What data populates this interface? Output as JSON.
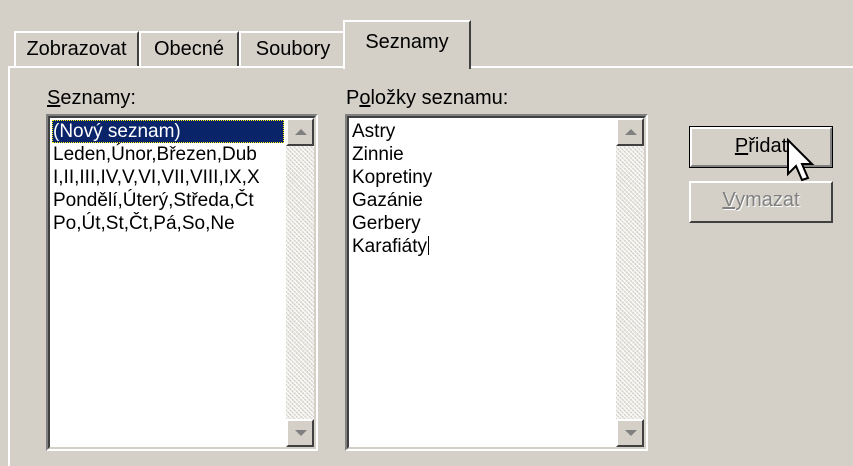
{
  "tabs": [
    {
      "label": "Zobrazovat"
    },
    {
      "label": "Obecné"
    },
    {
      "label": "Soubory"
    },
    {
      "label": "Seznamy"
    }
  ],
  "lists_label": {
    "accel": "S",
    "rest": "eznamy:"
  },
  "items_label": {
    "pre": "P",
    "accel": "o",
    "rest": "ložky seznamu:"
  },
  "lists": [
    "(Nový seznam)",
    "Leden,Únor,Březen,Dub",
    "I,II,III,IV,V,VI,VII,VIII,IX,X",
    "Pondělí,Úterý,Středa,Čt",
    "Po,Út,St,Čt,Pá,So,Ne"
  ],
  "entries": [
    "Astry",
    "Zinnie",
    "Kopretiny",
    "Gazánie",
    "Gerbery",
    "Karafiáty"
  ],
  "add_button": {
    "accel": "P",
    "rest": "řidat"
  },
  "delete_button": {
    "accel": "V",
    "rest": "ymazat"
  },
  "colors": {
    "selection": "#0a246a",
    "face": "#d4d0c8"
  }
}
